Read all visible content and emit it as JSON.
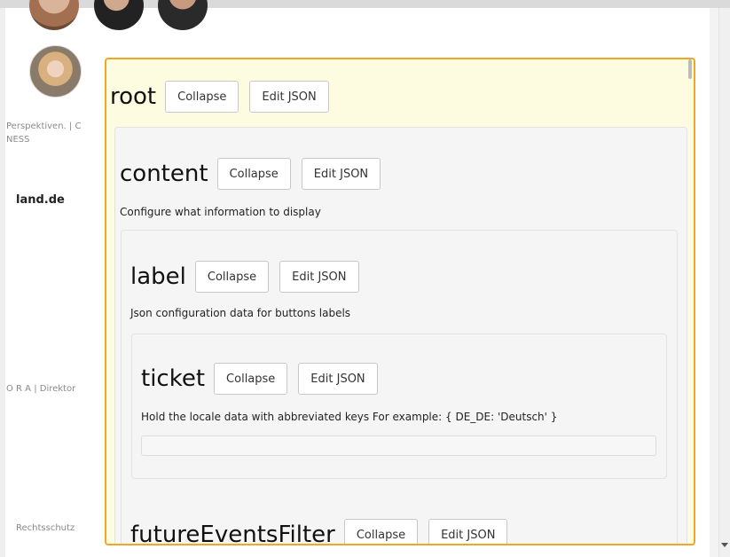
{
  "background": {
    "text1": "Perspektiven. | C",
    "text2": "NESS",
    "domain": "land.de",
    "text3": "O R A | Direktor",
    "text4": "Rechtsschutz"
  },
  "editor": {
    "root": {
      "title": "root",
      "collapse_label": "Collapse",
      "edit_json_label": "Edit JSON"
    },
    "content": {
      "title": "content",
      "collapse_label": "Collapse",
      "edit_json_label": "Edit JSON",
      "description": "Configure what information to display"
    },
    "label": {
      "title": "label",
      "collapse_label": "Collapse",
      "edit_json_label": "Edit JSON",
      "description": "Json configuration data for buttons labels"
    },
    "ticket": {
      "title": "ticket",
      "collapse_label": "Collapse",
      "edit_json_label": "Edit JSON",
      "description": "Hold the locale data with abbreviated keys For example: { DE_DE: 'Deutsch' }",
      "value": ""
    },
    "futureEventsFilter": {
      "title": "futureEventsFilter",
      "collapse_label": "Collapse",
      "edit_json_label": "Edit JSON"
    }
  }
}
